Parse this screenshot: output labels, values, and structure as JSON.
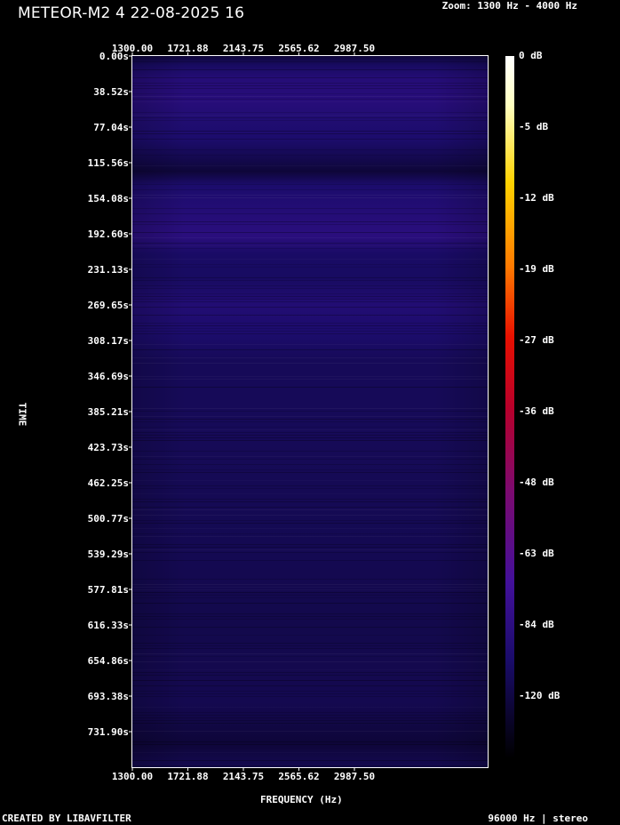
{
  "header": {
    "title": "METEOR-M2 4 22-08-2025 16",
    "zoom": "Zoom: 1300 Hz - 4000 Hz"
  },
  "footer": {
    "left": "CREATED BY LIBAVFILTER",
    "right": "96000 Hz | stereo"
  },
  "chart_data": {
    "type": "heatmap",
    "title": "METEOR-M2 4 22-08-2025 16",
    "xlabel": "FREQUENCY (Hz)",
    "ylabel": "TIME",
    "xlim": [
      1300,
      4000
    ],
    "ylim": [
      0,
      770.42
    ],
    "x_ticks": [
      "1300.00",
      "1721.88",
      "2143.75",
      "2565.62",
      "2987.50"
    ],
    "x_tick_values": [
      1300,
      1721.88,
      2143.75,
      2565.62,
      2987.5
    ],
    "y_ticks": [
      "0.00s",
      "38.52s",
      "77.04s",
      "115.56s",
      "154.08s",
      "192.60s",
      "231.13s",
      "269.65s",
      "308.17s",
      "346.69s",
      "385.21s",
      "423.73s",
      "462.25s",
      "500.77s",
      "539.29s",
      "577.81s",
      "616.33s",
      "654.86s",
      "693.38s",
      "731.90s"
    ],
    "y_tick_values": [
      0,
      38.52,
      77.04,
      115.56,
      154.08,
      192.6,
      231.13,
      269.65,
      308.17,
      346.69,
      385.21,
      423.73,
      462.25,
      500.77,
      539.29,
      577.81,
      616.33,
      654.86,
      693.38,
      731.9
    ],
    "colorbar": {
      "labels": [
        "0 dB",
        "-5 dB",
        "-12 dB",
        "-19 dB",
        "-27 dB",
        "-36 dB",
        "-48 dB",
        "-63 dB",
        "-84 dB",
        "-120 dB"
      ],
      "stops": [
        {
          "level": 0,
          "color": "#ffffff"
        },
        {
          "level": 0.07,
          "color": "#ffffc0"
        },
        {
          "level": 0.18,
          "color": "#ffd200"
        },
        {
          "level": 0.3,
          "color": "#ff7a00"
        },
        {
          "level": 0.4,
          "color": "#e81000"
        },
        {
          "level": 0.5,
          "color": "#b8002a"
        },
        {
          "level": 0.62,
          "color": "#7c0a70"
        },
        {
          "level": 0.75,
          "color": "#42109a"
        },
        {
          "level": 0.86,
          "color": "#1a0c6a"
        },
        {
          "level": 1,
          "color": "#000000"
        }
      ]
    },
    "intensity_db_by_time": [
      {
        "t": 0,
        "db": -125
      },
      {
        "t": 10,
        "db": -110
      },
      {
        "t": 25,
        "db": -95
      },
      {
        "t": 50,
        "db": -93
      },
      {
        "t": 70,
        "db": -100
      },
      {
        "t": 90,
        "db": -104
      },
      {
        "t": 110,
        "db": -118
      },
      {
        "t": 125,
        "db": -125
      },
      {
        "t": 140,
        "db": -104
      },
      {
        "t": 170,
        "db": -96
      },
      {
        "t": 195,
        "db": -90
      },
      {
        "t": 215,
        "db": -108
      },
      {
        "t": 240,
        "db": -110
      },
      {
        "t": 270,
        "db": -98
      },
      {
        "t": 300,
        "db": -104
      },
      {
        "t": 330,
        "db": -114
      },
      {
        "t": 400,
        "db": -114
      },
      {
        "t": 470,
        "db": -116
      },
      {
        "t": 540,
        "db": -117
      },
      {
        "t": 610,
        "db": -120
      },
      {
        "t": 700,
        "db": -118
      },
      {
        "t": 745,
        "db": -125
      },
      {
        "t": 770.42,
        "db": -118
      }
    ]
  }
}
